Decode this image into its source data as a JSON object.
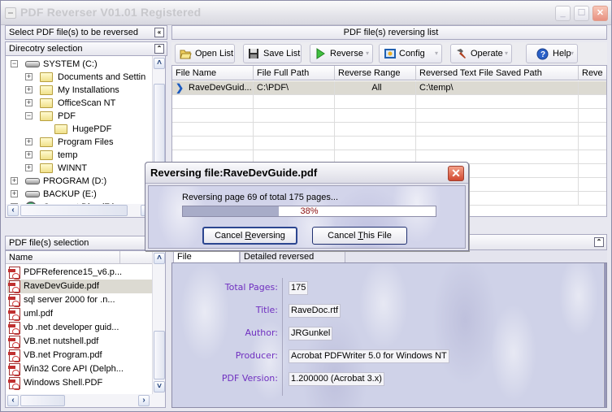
{
  "window": {
    "title": "PDF Reverser V01.01 Registered",
    "buttons": {
      "minimize": "_",
      "maximize": "☐",
      "close": "✕"
    }
  },
  "left": {
    "header": "Select PDF file(s) to be reversed",
    "collapse_icon": "«",
    "dir_header": "Direcotry selection",
    "dir_toggle": "⌃",
    "tree": [
      {
        "label": "SYSTEM (C:)",
        "type": "drive",
        "expanded": true
      },
      {
        "label": "Documents and Settin",
        "type": "folder"
      },
      {
        "label": "My Installations",
        "type": "folder"
      },
      {
        "label": "OfficeScan NT",
        "type": "folder"
      },
      {
        "label": "PDF",
        "type": "folder-open",
        "expanded": true
      },
      {
        "label": "HugePDF",
        "type": "folder"
      },
      {
        "label": "Program Files",
        "type": "folder"
      },
      {
        "label": "temp",
        "type": "folder"
      },
      {
        "label": "WINNT",
        "type": "folder"
      },
      {
        "label": "PROGRAM (D:)",
        "type": "drive"
      },
      {
        "label": "BACKUP (E:)",
        "type": "drive"
      },
      {
        "label": "Compact Disc (F:)",
        "type": "cd"
      }
    ],
    "file_header": "PDF file(s) selection",
    "file_col": "Name",
    "files": [
      "PDFReference15_v6.p...",
      "RaveDevGuide.pdf",
      "sql server 2000 for .n...",
      "uml.pdf",
      "vb .net developer guid...",
      "VB.net nutshell.pdf",
      "VB.net Program.pdf",
      "Win32 Core API (Delph...",
      "Windows Shell.PDF"
    ],
    "selected_file": "RaveDevGuide.pdf"
  },
  "main": {
    "header": "PDF file(s) reversing list",
    "toolbar": [
      {
        "label": "Open List",
        "icon": "folder-open-icon"
      },
      {
        "label": "Save List",
        "icon": "floppy-disk-icon"
      },
      {
        "label": "Reverse",
        "icon": "play-icon",
        "dropdown": true
      },
      {
        "label": "Config",
        "icon": "config-icon",
        "dropdown": true
      },
      {
        "label": "Operate",
        "icon": "hammer-icon",
        "dropdown": true
      },
      {
        "label": "Help",
        "icon": "help-icon",
        "dropdown": true
      }
    ],
    "columns": [
      "File Name",
      "File Full Path",
      "Reverse Range",
      "Reversed Text File Saved Path",
      "Reve"
    ],
    "rows": [
      {
        "file_name": "RaveDevGuid...",
        "full_path": "C:\\PDF\\",
        "range": "All",
        "saved_path": "C:\\temp\\",
        "extra": ""
      }
    ],
    "tabs": [
      "File information",
      "Detailed reversed results"
    ],
    "active_tab": "File information",
    "toggle": "⌃",
    "file_info": [
      {
        "label": "Total Pages:",
        "value": "175"
      },
      {
        "label": "Title:",
        "value": "RaveDoc.rtf"
      },
      {
        "label": "Author:",
        "value": "JRGunkel"
      },
      {
        "label": "Producer:",
        "value": "Acrobat PDFWriter 5.0 for Windows NT"
      },
      {
        "label": "PDF Version:",
        "value": "1.200000 (Acrobat 3.x)"
      }
    ]
  },
  "dialog": {
    "title": "Reversing file:RaveDevGuide.pdf",
    "status": "Reversing page 69 of total 175 pages...",
    "progress_percent": 38,
    "progress_label": "38%",
    "cancel_reversing": {
      "pre": "Cancel ",
      "accel": "R",
      "post": "eversing"
    },
    "cancel_file": {
      "pre": "Cancel ",
      "accel": "T",
      "post": "his File"
    }
  }
}
